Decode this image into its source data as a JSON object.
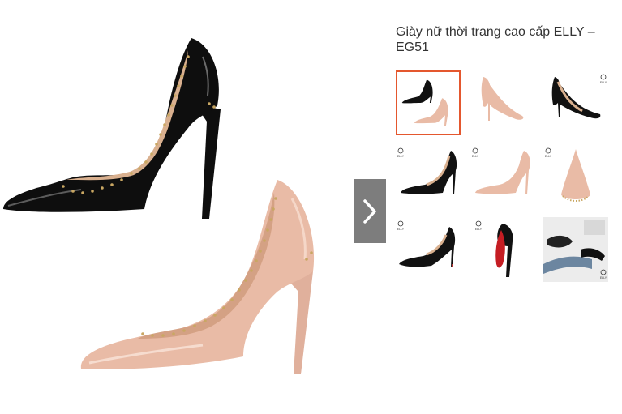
{
  "product": {
    "title": "Giày nữ thời trang cao cấp ELLY – EG51",
    "brand_mark": "ELLY"
  },
  "gallery": {
    "selected_index": 0,
    "thumbnails": [
      {
        "subject": "black-and-nude-pair"
      },
      {
        "subject": "nude-pump"
      },
      {
        "subject": "black-pump"
      },
      {
        "subject": "black-pump-side"
      },
      {
        "subject": "nude-pump-side"
      },
      {
        "subject": "nude-toe-closeup"
      },
      {
        "subject": "black-pump-angle"
      },
      {
        "subject": "black-pump-red-sole"
      },
      {
        "subject": "lifestyle-photo"
      }
    ]
  },
  "icons": {
    "next": "chevron-right-icon",
    "logo": "elly-logo-icon"
  },
  "colors": {
    "selected_border": "#e4572e",
    "arrow_bg": "#7d7d7d",
    "patent_black": "#0e0e0e",
    "nude": "#e9bba6",
    "lining": "#d9b08f",
    "stud": "#c9a763"
  }
}
